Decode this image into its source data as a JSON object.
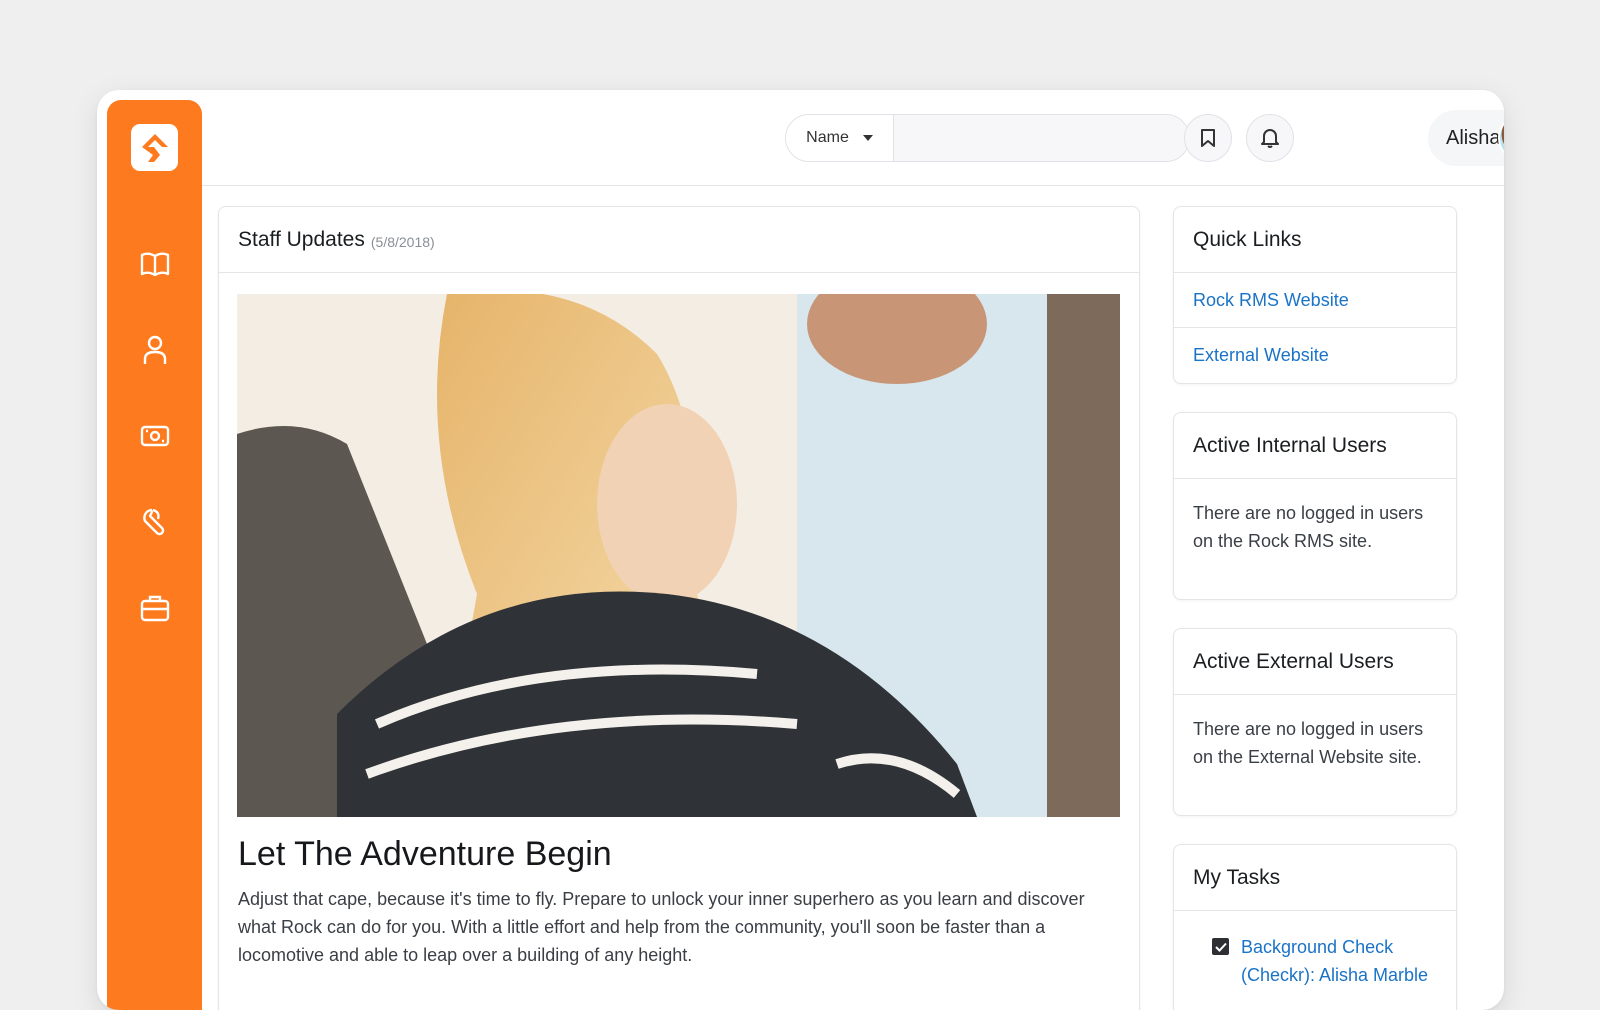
{
  "sidebar": {
    "logo": "rock-logo",
    "items": [
      {
        "icon": "book-icon",
        "label": "Library"
      },
      {
        "icon": "person-icon",
        "label": "People"
      },
      {
        "icon": "money-icon",
        "label": "Finance"
      },
      {
        "icon": "wrench-icon",
        "label": "Tools"
      },
      {
        "icon": "briefcase-icon",
        "label": "Admin"
      }
    ]
  },
  "header": {
    "search": {
      "type_label": "Name",
      "placeholder": "",
      "value": ""
    },
    "bookmark_icon": "bookmark-icon",
    "bell_icon": "bell-icon",
    "user": {
      "name": "Alisha"
    }
  },
  "staff_updates": {
    "title": "Staff Updates",
    "date": "(5/8/2018)",
    "article": {
      "title": "Let The Adventure Begin",
      "body": "Adjust that cape, because it's time to fly. Prepare to unlock your inner superhero as you learn and discover what Rock can do for you. With a little effort and help from the community, you'll soon be faster than a locomotive and able to leap over a building of any height."
    }
  },
  "quick_links": {
    "title": "Quick Links",
    "items": [
      "Rock RMS Website",
      "External Website"
    ]
  },
  "active_internal": {
    "title": "Active Internal Users",
    "message": "There are no logged in users on the Rock RMS site."
  },
  "active_external": {
    "title": "Active External Users",
    "message": "There are no logged in users on the External Website site."
  },
  "my_tasks": {
    "title": "My Tasks",
    "items": [
      "Background Check (Checkr): Alisha Marble"
    ]
  },
  "colors": {
    "accent": "#fe7a1e",
    "link": "#1a73c7"
  }
}
